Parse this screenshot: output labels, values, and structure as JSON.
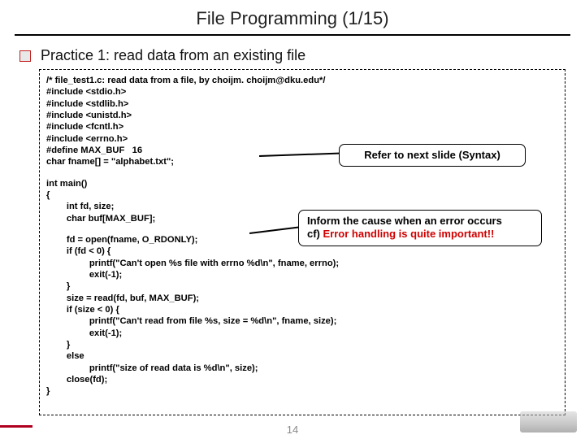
{
  "header": {
    "title": "File Programming (1/15)"
  },
  "subtitle": "Practice 1: read data from an existing file",
  "callouts": {
    "c1": "Refer to next slide (Syntax)",
    "c2a": "Inform the cause when an error occurs",
    "c2b_prefix": "cf) ",
    "c2b_red": "Error handling is quite important!!"
  },
  "code": [
    "/* file_test1.c: read data from a file, by choijm. choijm@dku.edu*/",
    "#include <stdio.h>",
    "#include <stdlib.h>",
    "#include <unistd.h>",
    "#include <fcntl.h>",
    "#include <errno.h>",
    "#define MAX_BUF   16",
    "char fname[] = \"alphabet.txt\";",
    "",
    "int main()",
    "{",
    "        int fd, size;",
    "        char buf[MAX_BUF];",
    "",
    "        fd = open(fname, O_RDONLY);",
    "        if (fd < 0) {",
    "                 printf(\"Can't open %s file with errno %d\\n\", fname, errno);",
    "                 exit(-1);",
    "        }",
    "        size = read(fd, buf, MAX_BUF);",
    "        if (size < 0) {",
    "                 printf(\"Can't read from file %s, size = %d\\n\", fname, size);",
    "                 exit(-1);",
    "        }",
    "        else",
    "                 printf(\"size of read data is %d\\n\", size);",
    "        close(fd);",
    "}"
  ],
  "page_number": "14"
}
